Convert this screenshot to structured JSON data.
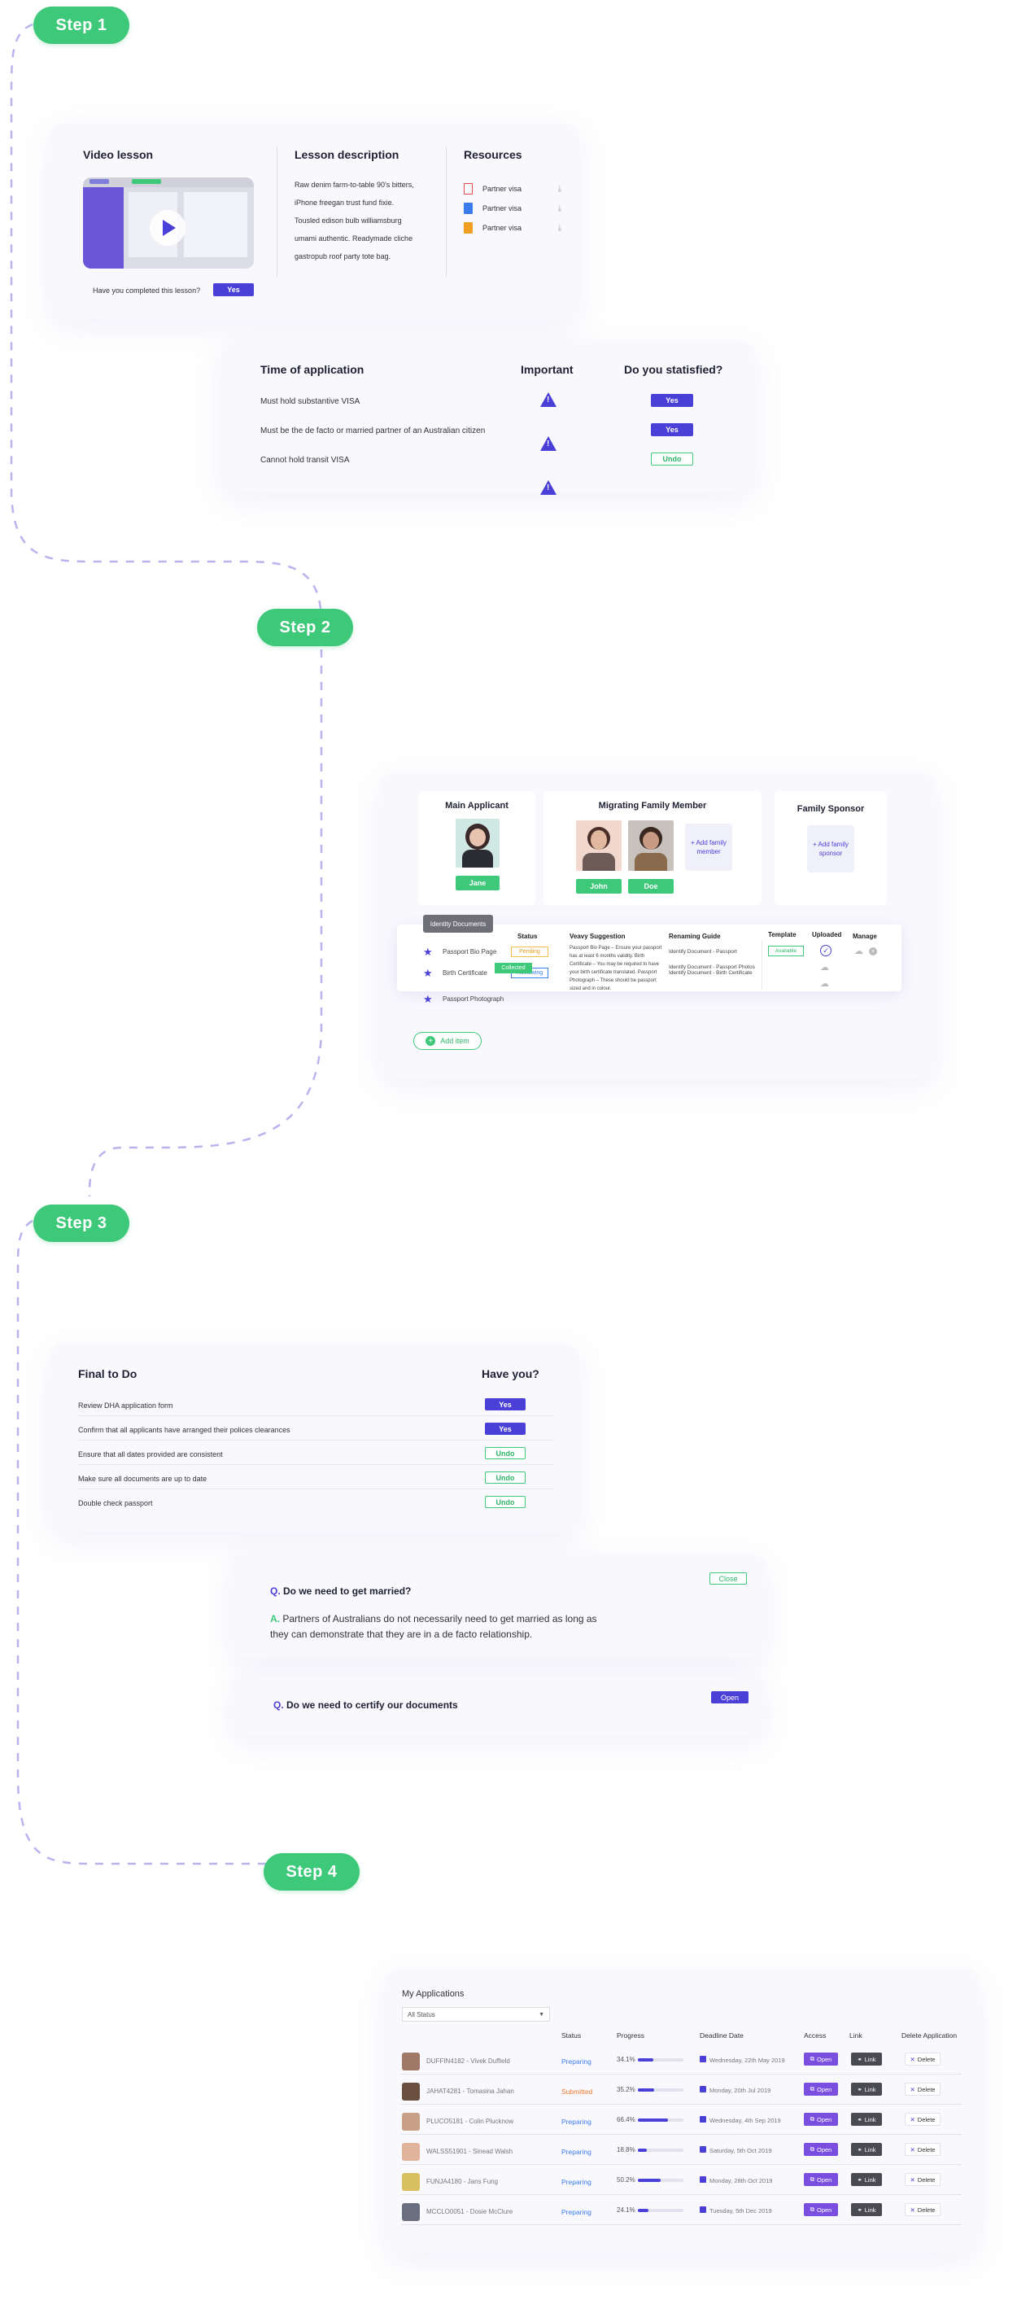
{
  "steps": {
    "s1": "Step 1",
    "s2": "Step 2",
    "s3": "Step 3",
    "s4": "Step 4"
  },
  "lesson": {
    "video_title": "Video lesson",
    "completed_q": "Have you completed this lesson?",
    "yes": "Yes",
    "desc_title": "Lesson description",
    "desc_text": "Raw denim farm-to-table 90's bitters, iPhone freegan trust fund fixie. Tousled edison bulb williamsburg umami authentic. Readymade cliche gastropub roof party tote bag.",
    "res_title": "Resources",
    "resources": [
      "Partner visa",
      "Partner visa",
      "Partner visa"
    ]
  },
  "application": {
    "col1": "Time of application",
    "col2": "Important",
    "col3": "Do you statisfied?",
    "rows": [
      {
        "text": "Must hold substantive VISA",
        "btn": "Yes"
      },
      {
        "text": "Must be the de facto or married partner of an Australian citizen",
        "btn": "Yes"
      },
      {
        "text": "Cannot hold transit VISA",
        "btn": "Undo"
      }
    ]
  },
  "family": {
    "main_title": "Main Applicant",
    "main_name": "Jane",
    "mig_title": "Migrating Family Member",
    "mig_names": [
      "John",
      "Doe"
    ],
    "add_family": "+ Add family member",
    "sponsor_title": "Family Sponsor",
    "add_sponsor": "+ Add family sponsor"
  },
  "docs": {
    "tab": "Identity Documents",
    "headers": {
      "status": "Status",
      "suggestion": "Veavy Suggestion",
      "guide": "Renaming Guide",
      "template": "Template",
      "uploaded": "Uploaded",
      "manage": "Manage"
    },
    "rows": [
      {
        "name": "Passport Bio Page",
        "status": "Pending",
        "guide": "Identify Document - Passport"
      },
      {
        "name": "Birth Certificate",
        "status": "Reviewing",
        "guide": "Identify Document - Birth Certificate"
      },
      {
        "name": "Passport Photograph",
        "status": "Collected",
        "guide": "Identify Document - Passport Photos"
      }
    ],
    "suggestion": "Passport Bio Page – Ensure your passport has at least 6 months validity. Birth Certificate – You may be required to have your birth certificate translated. Passport Photograph – These should be passport sized and in colour.",
    "template_btn": "Available",
    "add_item": "Add item"
  },
  "todo": {
    "title": "Final to Do",
    "col2": "Have you?",
    "rows": [
      {
        "text": "Review DHA application form",
        "btn": "Yes"
      },
      {
        "text": "Confirm that all applicants have arranged their polices clearances",
        "btn": "Yes"
      },
      {
        "text": "Ensure that all dates provided are consistent",
        "btn": "Undo"
      },
      {
        "text": "Make sure all documents are up to date",
        "btn": "Undo"
      },
      {
        "text": "Double check passport",
        "btn": "Undo"
      }
    ]
  },
  "faq": [
    {
      "q_prefix": "Q.",
      "q": "Do we need to get married?",
      "a_prefix": "A.",
      "a": "Partners of Australians do not necessarily need to get married as long as they can demonstrate that they are in a de facto relationship.",
      "btn": "Close"
    },
    {
      "q_prefix": "Q.",
      "q": "Do we need to certify our documents",
      "btn": "Open"
    }
  ],
  "apps": {
    "title": "My Applications",
    "filter": "All Status",
    "headers": {
      "status": "Status",
      "progress": "Progress",
      "deadline": "Deadline Date",
      "access": "Access",
      "link": "Link",
      "delete": "Delete Application"
    },
    "open": "Open",
    "link": "Link",
    "delete": "Delete",
    "rows": [
      {
        "name": "DUFFIN4182 - Vivek Duffield",
        "status": "Preparing",
        "progress": 34.1,
        "progress_label": "34.1%",
        "date": "Wednesday, 22th May 2019"
      },
      {
        "name": "JAHAT4281 - Tomasina Jahan",
        "status": "Submitted",
        "progress": 35.2,
        "progress_label": "35.2%",
        "date": "Monday, 20th Jul 2019"
      },
      {
        "name": "PLUCO5181 - Colin Plucknow",
        "status": "Preparing",
        "progress": 66.4,
        "progress_label": "66.4%",
        "date": "Wednesday, 4th Sep 2019"
      },
      {
        "name": "WALSS51901 - Sinead Walsh",
        "status": "Preparing",
        "progress": 18.8,
        "progress_label": "18.8%",
        "date": "Saturday, 5th Oct 2019"
      },
      {
        "name": "FUNJA4180 - Jans Fung",
        "status": "Preparing",
        "progress": 50.2,
        "progress_label": "50.2%",
        "date": "Monday, 28th Oct 2019"
      },
      {
        "name": "MCCLO0051 - Dosie McClure",
        "status": "Preparing",
        "progress": 24.1,
        "progress_label": "24.1%",
        "date": "Tuesday, 5th Dec 2019"
      }
    ]
  },
  "colors": {
    "green": "#3ec97a",
    "purple": "#4a3fd6",
    "orange": "#f0772e",
    "blue": "#3a7bf0"
  }
}
